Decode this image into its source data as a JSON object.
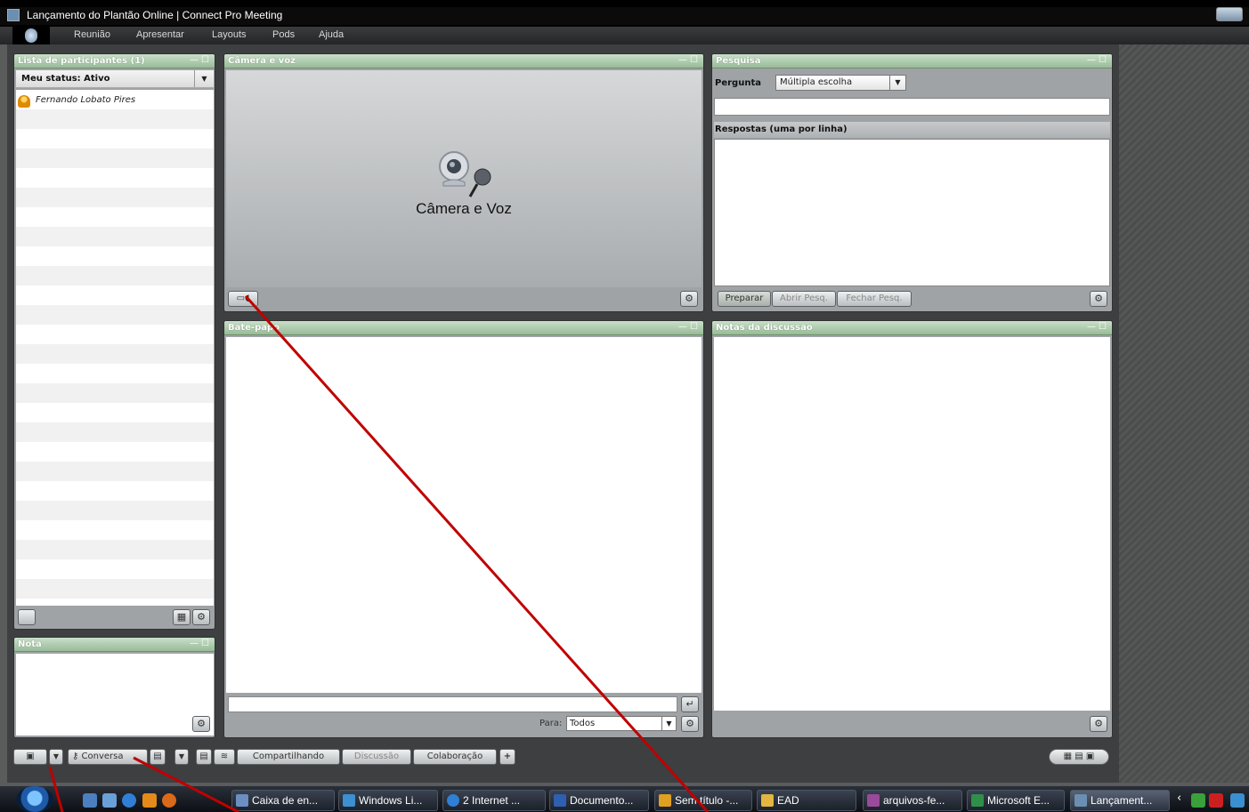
{
  "window": {
    "title": "Lançamento do Plantão Online | Connect Pro Meeting"
  },
  "menu": [
    "Reunião",
    "Apresentar",
    "Layouts",
    "Pods",
    "Ajuda"
  ],
  "participants": {
    "title": "Lista de participantes (1)",
    "status": "Meu status: Ativo",
    "people": [
      "Fernando Lobato Pires"
    ]
  },
  "note": {
    "title": "Nota"
  },
  "camera": {
    "title": "Câmera e voz",
    "label": "Câmera e Voz"
  },
  "chat": {
    "title": "Bate-papo",
    "to_label": "Para:",
    "to_value": "Todos"
  },
  "poll": {
    "title": "Pesquisa",
    "question_label": "Pergunta",
    "question_type": "Múltipla escolha",
    "answers_label": "Respostas (uma por linha)",
    "prepare": "Preparar",
    "open": "Abrir Pesq.",
    "close": "Fechar Pesq."
  },
  "discussion_notes": {
    "title": "Notas da discussão"
  },
  "layouts": {
    "conversa": "Conversa",
    "compartilhando": "Compartilhando",
    "discussao": "Discussão",
    "colaboracao": "Colaboração",
    "add": "+"
  },
  "taskbar": {
    "tasks": [
      "Caixa de en...",
      "Windows Li...",
      "2 Internet ...",
      "Documento...",
      "Sem título -...",
      "EAD",
      "arquivos-fe...",
      "Microsoft E...",
      "Lançament..."
    ]
  },
  "colors": {
    "pod_header": "#a9c9a9",
    "annotation": "#c00000"
  }
}
